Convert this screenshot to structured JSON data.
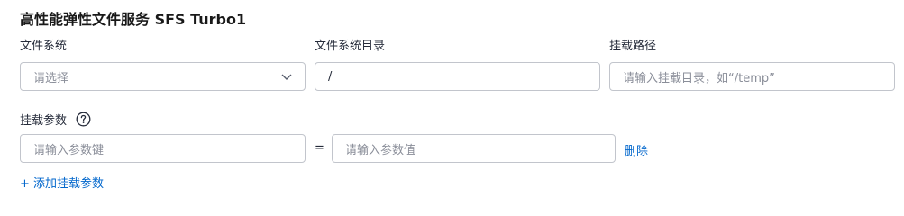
{
  "section": {
    "title": "高性能弹性文件服务 SFS Turbo1"
  },
  "fields": {
    "file_system": {
      "label": "文件系统",
      "placeholder": "请选择"
    },
    "directory": {
      "label": "文件系统目录",
      "value": "/"
    },
    "mount_path": {
      "label": "挂载路径",
      "placeholder": "请输入挂载目录，如“/temp”"
    }
  },
  "mount_params": {
    "label": "挂载参数",
    "key_placeholder": "请输入参数键",
    "separator": "=",
    "value_placeholder": "请输入参数值",
    "delete_label": "删除",
    "add_label": "+ 添加挂载参数"
  },
  "icons": {
    "dropdown": "chevron-down-icon",
    "help": "question-circle-icon"
  },
  "colors": {
    "link": "#0066cc",
    "border": "#c2c5cc",
    "placeholder": "#8a8e99"
  }
}
